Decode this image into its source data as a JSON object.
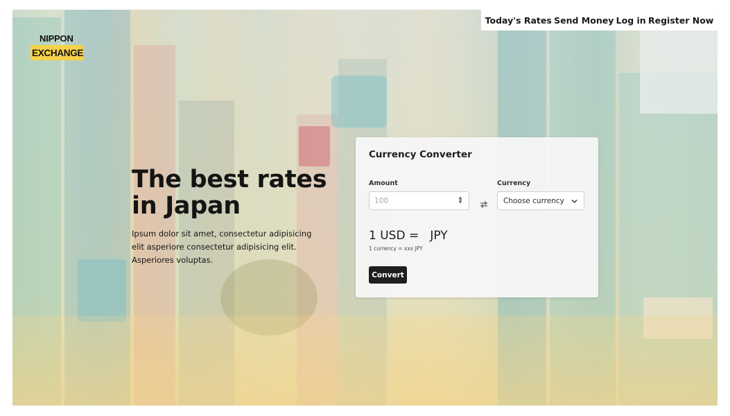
{
  "nav": {
    "items": [
      {
        "label": "Today's Rates"
      },
      {
        "label": "Send Money"
      },
      {
        "label": "Log in"
      },
      {
        "label": "Register Now"
      }
    ]
  },
  "logo": {
    "top": "NIPPON",
    "bottom": "EXCHANGE"
  },
  "hero": {
    "title": "The best rates in Japan",
    "subtitle": "Ipsum dolor sit amet, consectetur adipisicing elit asperiore consectetur adipisicing elit. Asperiores voluptas."
  },
  "converter": {
    "title": "Currency Converter",
    "amount_label": "Amount",
    "amount_placeholder": "100",
    "currency_label": "Currency",
    "currency_selected": "Choose currency",
    "rate_text": "1 USD =   JPY",
    "rate_note": "1 currency = xxx JPY",
    "convert_label": "Convert"
  },
  "colors": {
    "logo_accent": "#f5d24a",
    "button_bg": "#1f1f1f",
    "text_dark": "#141414"
  },
  "icons": {
    "swap": "swap-arrows-icon",
    "chevron": "chevron-down-icon",
    "stepper": "number-stepper-icon"
  }
}
